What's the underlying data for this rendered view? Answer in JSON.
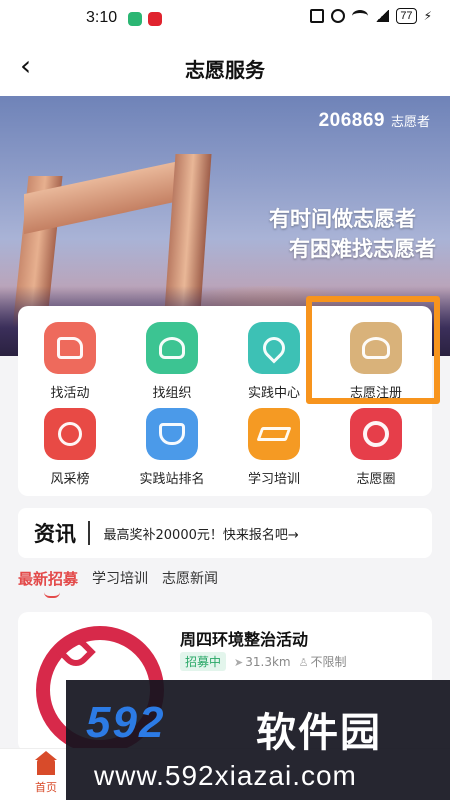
{
  "status_bar": {
    "time": "3:10",
    "battery": "77"
  },
  "nav": {
    "title": "志愿服务"
  },
  "banner": {
    "counter_number": "206869",
    "counter_unit": "志愿者",
    "slogan_line1": "有时间做志愿者",
    "slogan_line2": "有困难找志愿者"
  },
  "services": [
    {
      "label": "找活动",
      "color": "#ee6a5c",
      "icon": "flag-icon"
    },
    {
      "label": "找组织",
      "color": "#3cc492",
      "icon": "people-icon"
    },
    {
      "label": "实践中心",
      "color": "#3dc1b5",
      "icon": "heart-hand-icon"
    },
    {
      "label": "志愿注册",
      "color": "#d9b27a",
      "icon": "volunteer-register-icon"
    },
    {
      "label": "风采榜",
      "color": "#e84a45",
      "icon": "medal-icon"
    },
    {
      "label": "实践站排名",
      "color": "#4b9ae9",
      "icon": "trophy-icon"
    },
    {
      "label": "学习培训",
      "color": "#f59a23",
      "icon": "graduation-cap-icon"
    },
    {
      "label": "志愿圈",
      "color": "#e63e4a",
      "icon": "ring-icon"
    }
  ],
  "news": {
    "logo": "资讯",
    "text": "最高奖补20000元！快来报名吧→"
  },
  "tabs": [
    {
      "label": "最新招募",
      "active": true
    },
    {
      "label": "学习培训",
      "active": false
    },
    {
      "label": "志愿新闻",
      "active": false
    }
  ],
  "activity": {
    "title": "周四环境整治活动",
    "status": "招募中",
    "distance": "31.3km",
    "limit": "不限制"
  },
  "bottom_nav": {
    "home_label": "首页"
  },
  "watermark": {
    "brand": "592",
    "brand_cn": "软件园",
    "url": "www.592xiazai.com"
  }
}
